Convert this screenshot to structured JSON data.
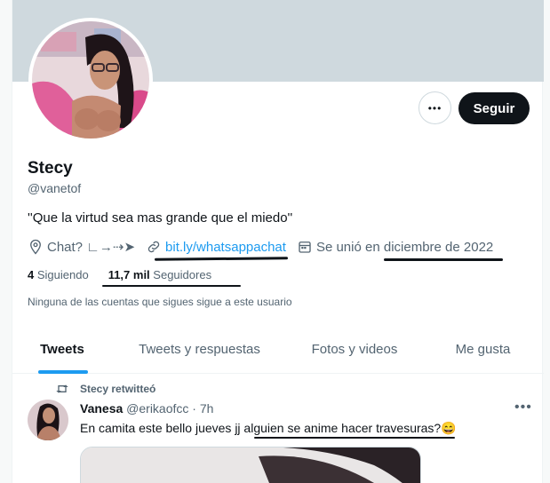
{
  "profile": {
    "name": "Stecy",
    "handle": "@vanetof",
    "bio": "''Que la virtud sea mas grande que el miedo''",
    "location": "Chat? ∟→⇢➤",
    "link": "bit.ly/whatsappachat",
    "joined": "Se unió en diciembre de 2022",
    "following_count": "4",
    "following_label": "Siguiendo",
    "followers_count": "11,7 mil",
    "followers_label": "Seguidores",
    "no_mutual": "Ninguna de las cuentas que sigues sigue a este usuario"
  },
  "actions": {
    "follow_label": "Seguir",
    "more_label": "•••"
  },
  "tabs": [
    {
      "label": "Tweets",
      "active": true
    },
    {
      "label": "Tweets y respuestas",
      "active": false
    },
    {
      "label": "Fotos y videos",
      "active": false
    },
    {
      "label": "Me gusta",
      "active": false
    }
  ],
  "tweet": {
    "retweet_label": "Stecy retwitteó",
    "author": "Vanesa",
    "author_handle": "@erikaofcc",
    "time": "· 7h",
    "text": "En camita este bello jueves jj alguien se anime hacer travesuras?😄",
    "more_label": "•••"
  },
  "colors": {
    "accent": "#1d9bf0",
    "banner": "#cfd9de",
    "dark_button": "#0f1419",
    "secondary_text": "#536471"
  },
  "icons": {
    "location": "location-pin-icon",
    "link": "link-icon",
    "calendar": "calendar-icon",
    "retweet": "retweet-icon"
  }
}
